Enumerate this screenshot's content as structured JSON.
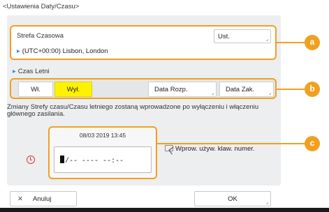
{
  "header": {
    "title": "<Ustawienia Daty/Czasu>"
  },
  "timezone": {
    "label": "Strefa Czasowa",
    "button_label": "Ust.",
    "value": "(UTC+00:00) Lisbon, London"
  },
  "dst": {
    "label": "Czas Letni",
    "on_label": "Wł.",
    "off_label": "Wył.",
    "selected": "Wył.",
    "start_date_label": "Data Rozp.",
    "end_date_label": "Data Zak."
  },
  "notice": "Zmiany Strefy czasu/Czasu letniego zostaną wprowadzone po wyłączeniu i włączeniu głównego zasilania.",
  "datetime": {
    "current": "08/03 2019 13:45",
    "input_value": "/-- ---- --:--"
  },
  "keyboard_button": "Wprow. używ. klaw. numer.",
  "callouts": {
    "a": "a",
    "b": "b",
    "c": "c"
  },
  "footer": {
    "cancel_label": "Anuluj",
    "ok_label": "OK"
  },
  "icons": {
    "arrow": "arrow-right-icon",
    "clock": "clock-icon",
    "keyboard": "keyboard-icon",
    "close": "close-icon"
  },
  "colors": {
    "accent": "#f0a020",
    "selected": "#fff200",
    "link": "#3a8ad8",
    "clock": "#d83a3a"
  }
}
